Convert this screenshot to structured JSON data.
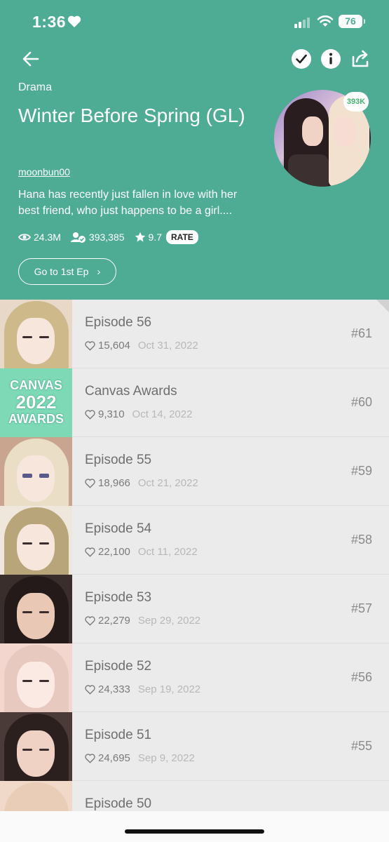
{
  "status_bar": {
    "time": "1:36",
    "battery": "76"
  },
  "header": {
    "genre": "Drama",
    "title": "Winter Before Spring (GL)",
    "author": "moonbun00",
    "summary": "Hana has recently just fallen in love with her best friend, who just happens to be a girl....",
    "cover_badge": "393K",
    "stats": {
      "views": "24.3M",
      "subscribers": "393,385",
      "rating": "9.7",
      "rate_label": "RATE"
    },
    "first_ep_label": "Go to 1st Ep",
    "icons": [
      "back-arrow-icon",
      "check-icon",
      "info-icon",
      "share-icon"
    ],
    "colors": {
      "header_bg": "#4eac94",
      "badge_text": "#3fb56c"
    }
  },
  "episodes": [
    {
      "title": "Episode 56",
      "likes": "15,604",
      "date": "Oct 31, 2022",
      "num": "#61"
    },
    {
      "title": "Canvas Awards",
      "likes": "9,310",
      "date": "Oct 14, 2022",
      "num": "#60",
      "thumb_text": [
        "CANVAS",
        "2022",
        "AWARDS"
      ]
    },
    {
      "title": "Episode 55",
      "likes": "18,966",
      "date": "Oct 21, 2022",
      "num": "#59"
    },
    {
      "title": "Episode 54",
      "likes": "22,100",
      "date": "Oct 11, 2022",
      "num": "#58"
    },
    {
      "title": "Episode 53",
      "likes": "22,279",
      "date": "Sep 29, 2022",
      "num": "#57"
    },
    {
      "title": "Episode 52",
      "likes": "24,333",
      "date": "Sep 19, 2022",
      "num": "#56"
    },
    {
      "title": "Episode 51",
      "likes": "24,695",
      "date": "Sep 9, 2022",
      "num": "#55"
    },
    {
      "title": "Episode 50"
    }
  ]
}
